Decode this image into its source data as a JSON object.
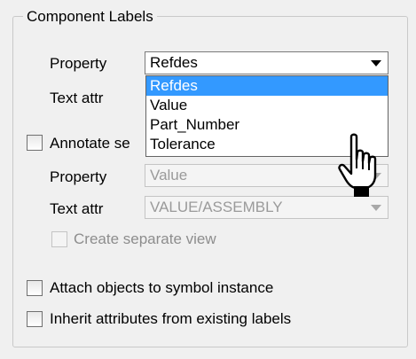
{
  "group": {
    "title": "Component Labels"
  },
  "row1": {
    "property_label": "Property",
    "property_value": "Refdes",
    "text_attr_label": "Text attr"
  },
  "dropdown": {
    "items": [
      "Refdes",
      "Value",
      "Part_Number",
      "Tolerance"
    ],
    "selected_index": 0
  },
  "annotate": {
    "label": "Annotate se",
    "checked": false
  },
  "row2": {
    "property_label": "Property",
    "property_value": "Value",
    "text_attr_label": "Text attr",
    "text_attr_value": "VALUE/ASSEMBLY",
    "create_view_label": "Create separate view"
  },
  "attach": {
    "label": "Attach objects to symbol instance",
    "checked": false
  },
  "inherit": {
    "label": "Inherit attributes from existing labels",
    "checked": false
  },
  "colors": {
    "selection": "#3399ff",
    "panel": "#f0f0f0",
    "disabled_text": "#8d8d8d"
  },
  "cursor": {
    "icon": "hand-pointer-icon"
  }
}
